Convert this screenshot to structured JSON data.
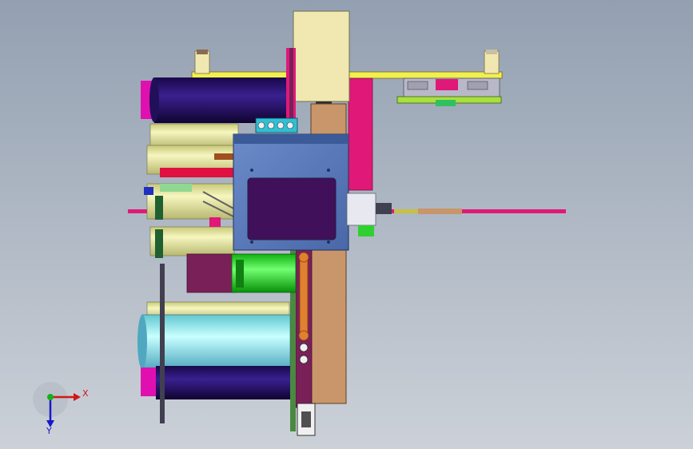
{
  "viewport": {
    "background_top": "#93a0b1",
    "background_bottom": "#ccd1d8"
  },
  "triad": {
    "x_label": "X",
    "y_label": "Y",
    "x_color": "#d01818",
    "y_color": "#1818c8",
    "origin_color": "#18b018"
  },
  "colors": {
    "magenta": "#e010b0",
    "navy": "#20105a",
    "light_yellow": "#f2f2a8",
    "cream": "#f0e8b0",
    "tan": "#c8966a",
    "pink": "#e01878",
    "lime": "#a8e040",
    "green": "#20e020",
    "steel_blue": "#5a7ab8",
    "purple": "#40105a",
    "cyan": "#90f0f0",
    "red": "#e01040",
    "teal": "#30c0d0",
    "yellow_bar": "#f0f050",
    "maroon": "#7a2058"
  }
}
